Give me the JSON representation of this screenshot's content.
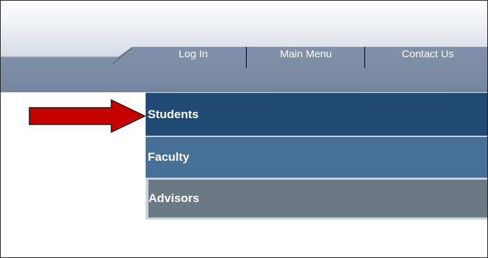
{
  "nav": {
    "login": "Log In",
    "main_menu": "Main Menu",
    "contact_us": "Contact Us"
  },
  "menu": {
    "students": "Students",
    "faculty": "Faculty",
    "advisors": "Advisors"
  },
  "colors": {
    "nav_bar": "#7b8aa2",
    "students_bg": "#1f4a74",
    "faculty_bg": "#466f97",
    "advisors_bg": "#6b7a82",
    "arrow": "#c40000"
  },
  "annotation_arrow": "red-pointer-arrow"
}
